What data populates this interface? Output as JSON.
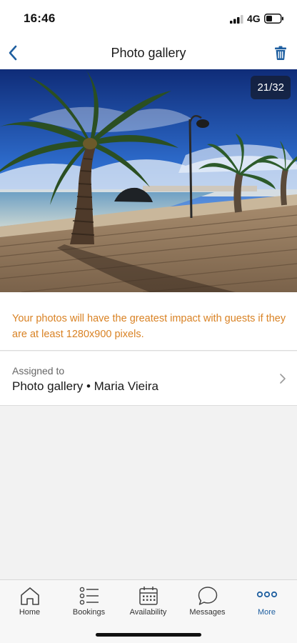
{
  "status_bar": {
    "time": "16:46",
    "network": "4G"
  },
  "nav": {
    "title": "Photo gallery",
    "back_icon": "chevron-left-icon",
    "delete_icon": "trash-icon",
    "accent_color": "#1f5fa0"
  },
  "photo": {
    "counter": "21/32"
  },
  "tip": {
    "text": "Your photos will have the greatest impact with guests if they are at least 1280x900 pixels.",
    "color": "#d98224"
  },
  "assigned": {
    "label": "Assigned to",
    "value": "Photo gallery • Maria Vieira"
  },
  "tabs": [
    {
      "label": "Home",
      "icon": "home-icon",
      "active": false
    },
    {
      "label": "Bookings",
      "icon": "list-icon",
      "active": false
    },
    {
      "label": "Availability",
      "icon": "calendar-icon",
      "active": false
    },
    {
      "label": "Messages",
      "icon": "chat-bubble-icon",
      "active": false
    },
    {
      "label": "More",
      "icon": "more-dots-icon",
      "active": true
    }
  ]
}
